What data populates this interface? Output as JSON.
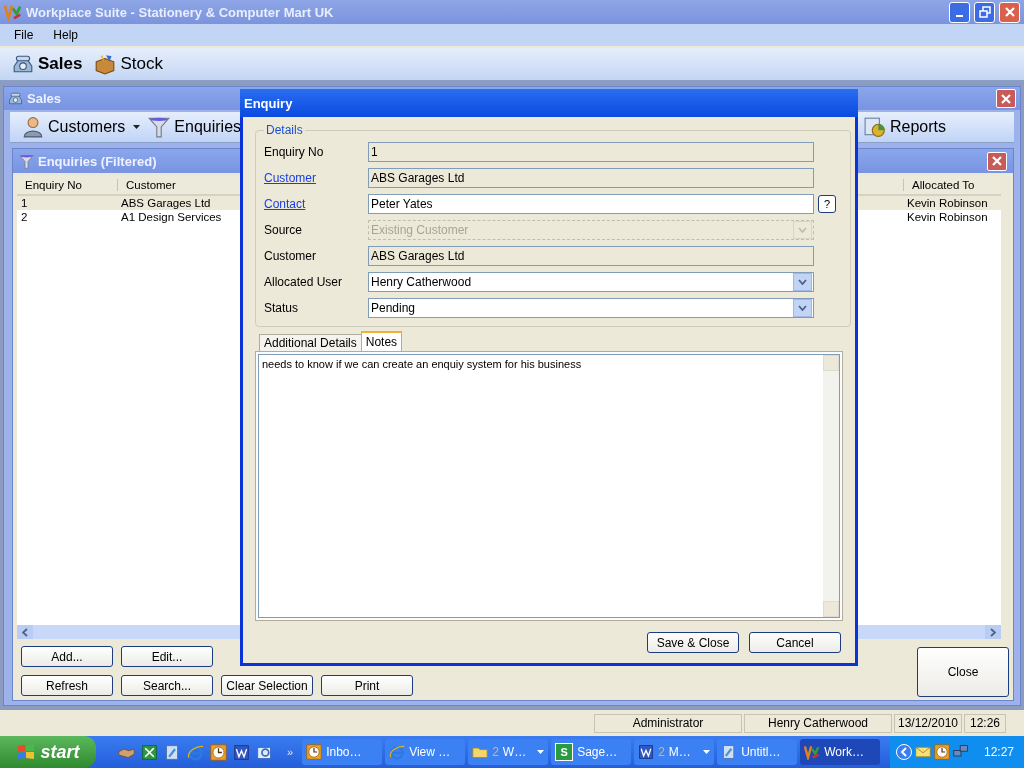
{
  "window": {
    "title": "Workplace Suite - Stationery & Computer Mart UK"
  },
  "menu": [
    "File",
    "Help"
  ],
  "main_toolbar": [
    {
      "label": "Sales",
      "kind": "phone",
      "selected": true
    },
    {
      "label": "Stock",
      "kind": "box",
      "selected": false
    }
  ],
  "sales_window": {
    "title": "Sales",
    "toolbar": [
      {
        "label": "Customers",
        "kind": "person",
        "dropdown": true
      },
      {
        "label": "Enquiries",
        "kind": "funnel",
        "dropdown": false
      },
      {
        "label": "Reports",
        "kind": "report",
        "dropdown": false
      }
    ]
  },
  "enquiries_panel": {
    "title": "Enquiries (Filtered)",
    "columns": [
      "Enquiry No",
      "Customer",
      "Allocated To"
    ],
    "rows": [
      {
        "cells": [
          "1",
          "ABS Garages Ltd",
          "Kevin Robinson"
        ],
        "selected": true
      },
      {
        "cells": [
          "2",
          "A1 Design Services",
          "Kevin Robinson"
        ],
        "selected": false
      }
    ],
    "buttons_row_1": [
      "Add...",
      "Edit..."
    ],
    "buttons_row_2": [
      "Refresh",
      "Search...",
      "Clear Selection",
      "Print"
    ],
    "close_button": "Close"
  },
  "status_bar": [
    "Administrator",
    "Henry Catherwood",
    "13/12/2010",
    "12:26"
  ],
  "dialog": {
    "title": "Enquiry",
    "group": "Details",
    "fields": [
      {
        "label": "Enquiry No",
        "value": "1",
        "kind": "readonly",
        "link": false
      },
      {
        "label": "Customer",
        "value": "ABS Garages Ltd",
        "kind": "readonly",
        "link": true
      },
      {
        "label": "Contact",
        "value": "Peter Yates",
        "kind": "text",
        "link": true,
        "help_button": "?"
      },
      {
        "label": "Source",
        "value": "Existing Customer",
        "kind": "dropdown",
        "link": false,
        "disabled": true
      },
      {
        "label": "Customer",
        "value": "ABS Garages Ltd",
        "kind": "readonly",
        "link": false
      },
      {
        "label": "Allocated User",
        "value": "Henry Catherwood",
        "kind": "dropdown",
        "link": false,
        "disabled": false
      },
      {
        "label": "Status",
        "value": "Pending",
        "kind": "dropdown",
        "link": false,
        "disabled": false
      }
    ],
    "tabs": [
      {
        "label": "Additional Details",
        "selected": false
      },
      {
        "label": "Notes",
        "selected": true
      }
    ],
    "notes": "needs to know if we can create an enquiy system for his business",
    "buttons": [
      "Save & Close",
      "Cancel"
    ]
  },
  "taskbar": {
    "start": "start",
    "quick_launch_more": "»",
    "tasks": [
      {
        "label": "Inbo…",
        "kind": "clock",
        "selected": false
      },
      {
        "label": "View …",
        "kind": "ie",
        "selected": false
      },
      {
        "count": "2",
        "label": "W…",
        "kind": "folder",
        "dropdown": true,
        "selected": false
      },
      {
        "label": "Sage…",
        "kind": "sage",
        "icon_letter": "S",
        "selected": false
      },
      {
        "count": "2",
        "label": "M…",
        "kind": "word",
        "dropdown": true,
        "selected": false
      },
      {
        "label": "Untitl…",
        "kind": "doc",
        "selected": false
      },
      {
        "label": "Work…",
        "kind": "logo",
        "selected": true
      }
    ],
    "clock": "12:27"
  }
}
